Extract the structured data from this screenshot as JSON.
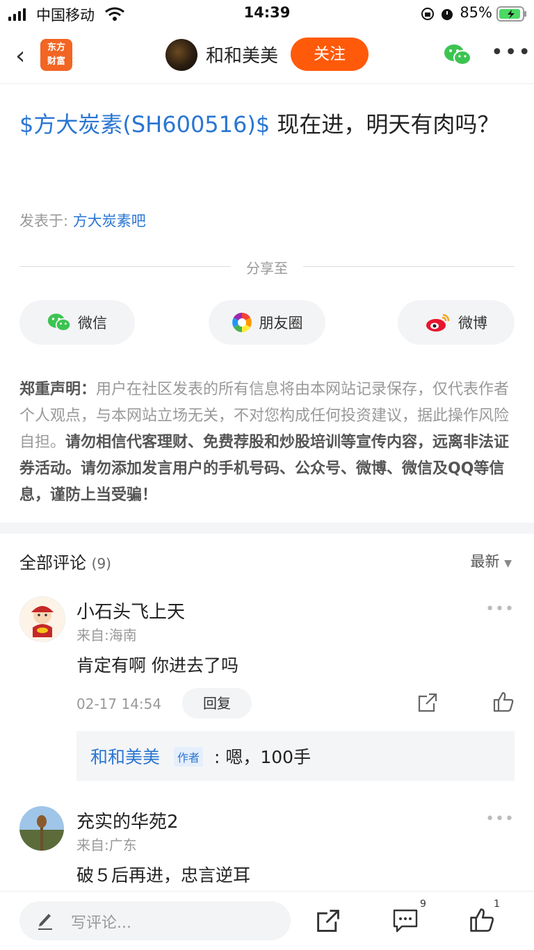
{
  "status_bar": {
    "carrier": "中国移动",
    "time": "14:39",
    "battery": "85%"
  },
  "nav": {
    "app_logo": "东方财富",
    "author": "和和美美",
    "follow": "关注"
  },
  "post": {
    "stock_tag": "$方大炭素(SH600516)$",
    "title_rest": " 现在进，明天有肉吗？",
    "posted_prefix": "发表于: ",
    "posted_bar": "方大炭素吧"
  },
  "share": {
    "label": "分享至",
    "targets": [
      {
        "label": "微信",
        "icon": "wechat-icon"
      },
      {
        "label": "朋友圈",
        "icon": "moments-icon"
      },
      {
        "label": "微博",
        "icon": "weibo-icon"
      }
    ]
  },
  "disclaimer": {
    "head": "郑重声明：",
    "normal": "用户在社区发表的所有信息将由本网站记录保存，仅代表作者个人观点，与本网站立场无关，不对您构成任何投资建议，据此操作风险自担。",
    "bold": "请勿相信代客理财、免费荐股和炒股培训等宣传内容，远离非法证券活动。请勿添加发言用户的手机号码、公众号、微博、微信及QQ等信息，谨防上当受骗！"
  },
  "comments_section": {
    "title": "全部评论",
    "count": "(9)",
    "sort": "最新"
  },
  "comments": [
    {
      "name": "小石头飞上天",
      "location": "来自:海南",
      "text": "肯定有啊 你进去了吗",
      "time": "02-17 14:54",
      "reply_label": "回复",
      "reply": {
        "author": "和和美美",
        "tag": "作者",
        "text": ": 嗯，100手"
      }
    },
    {
      "name": "充实的华苑2",
      "location": "来自:广东",
      "text": "破５后再进，忠言逆耳"
    }
  ],
  "bottom_bar": {
    "placeholder": "写评论...",
    "comment_count": "9",
    "like_count": "1"
  },
  "colors": {
    "accent": "#2a76d2",
    "follow": "#ff5a0a"
  }
}
